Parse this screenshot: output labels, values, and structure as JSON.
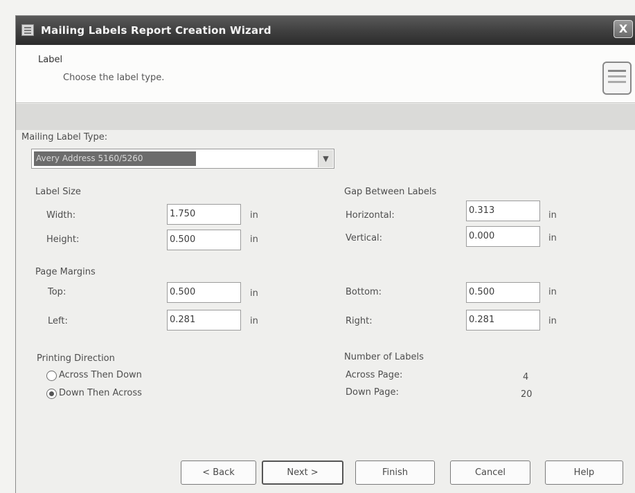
{
  "window": {
    "title": "Mailing Labels Report Creation Wizard",
    "close_label": "X"
  },
  "header": {
    "step_title": "Label",
    "step_description": "Choose the label type."
  },
  "label_type": {
    "label": "Mailing Label Type:",
    "selected_value": "Avery Address 5160/5260"
  },
  "label_size": {
    "group_label": "Label Size",
    "width_label": "Width:",
    "width_value": "1.750",
    "height_label": "Height:",
    "height_value": "0.500",
    "unit": "in"
  },
  "gap_between_labels": {
    "group_label": "Gap Between Labels",
    "horizontal_label": "Horizontal:",
    "horizontal_value": "0.313",
    "vertical_label": "Vertical:",
    "vertical_value": "0.000",
    "unit": "in"
  },
  "page_margins": {
    "group_label": "Page Margins",
    "top_label": "Top:",
    "top_value": "0.500",
    "left_label": "Left:",
    "left_value": "0.281",
    "bottom_label": "Bottom:",
    "bottom_value": "0.500",
    "right_label": "Right:",
    "right_value": "0.281",
    "unit": "in"
  },
  "printing_direction": {
    "group_label": "Printing Direction",
    "options": [
      {
        "label": "Across Then Down",
        "selected": false
      },
      {
        "label": "Down Then Across",
        "selected": true
      }
    ]
  },
  "number_of_labels": {
    "group_label": "Number of Labels",
    "across_label": "Across Page:",
    "across_value": "4",
    "down_label": "Down Page:",
    "down_value": "20"
  },
  "buttons": {
    "back": "< Back",
    "next": "Next >",
    "finish": "Finish",
    "cancel": "Cancel",
    "help": "Help"
  },
  "icons": {
    "title_icon": "report-icon",
    "wizard_icon": "mailing-label-icon",
    "dropdown_icon": "chevron-down-icon"
  }
}
